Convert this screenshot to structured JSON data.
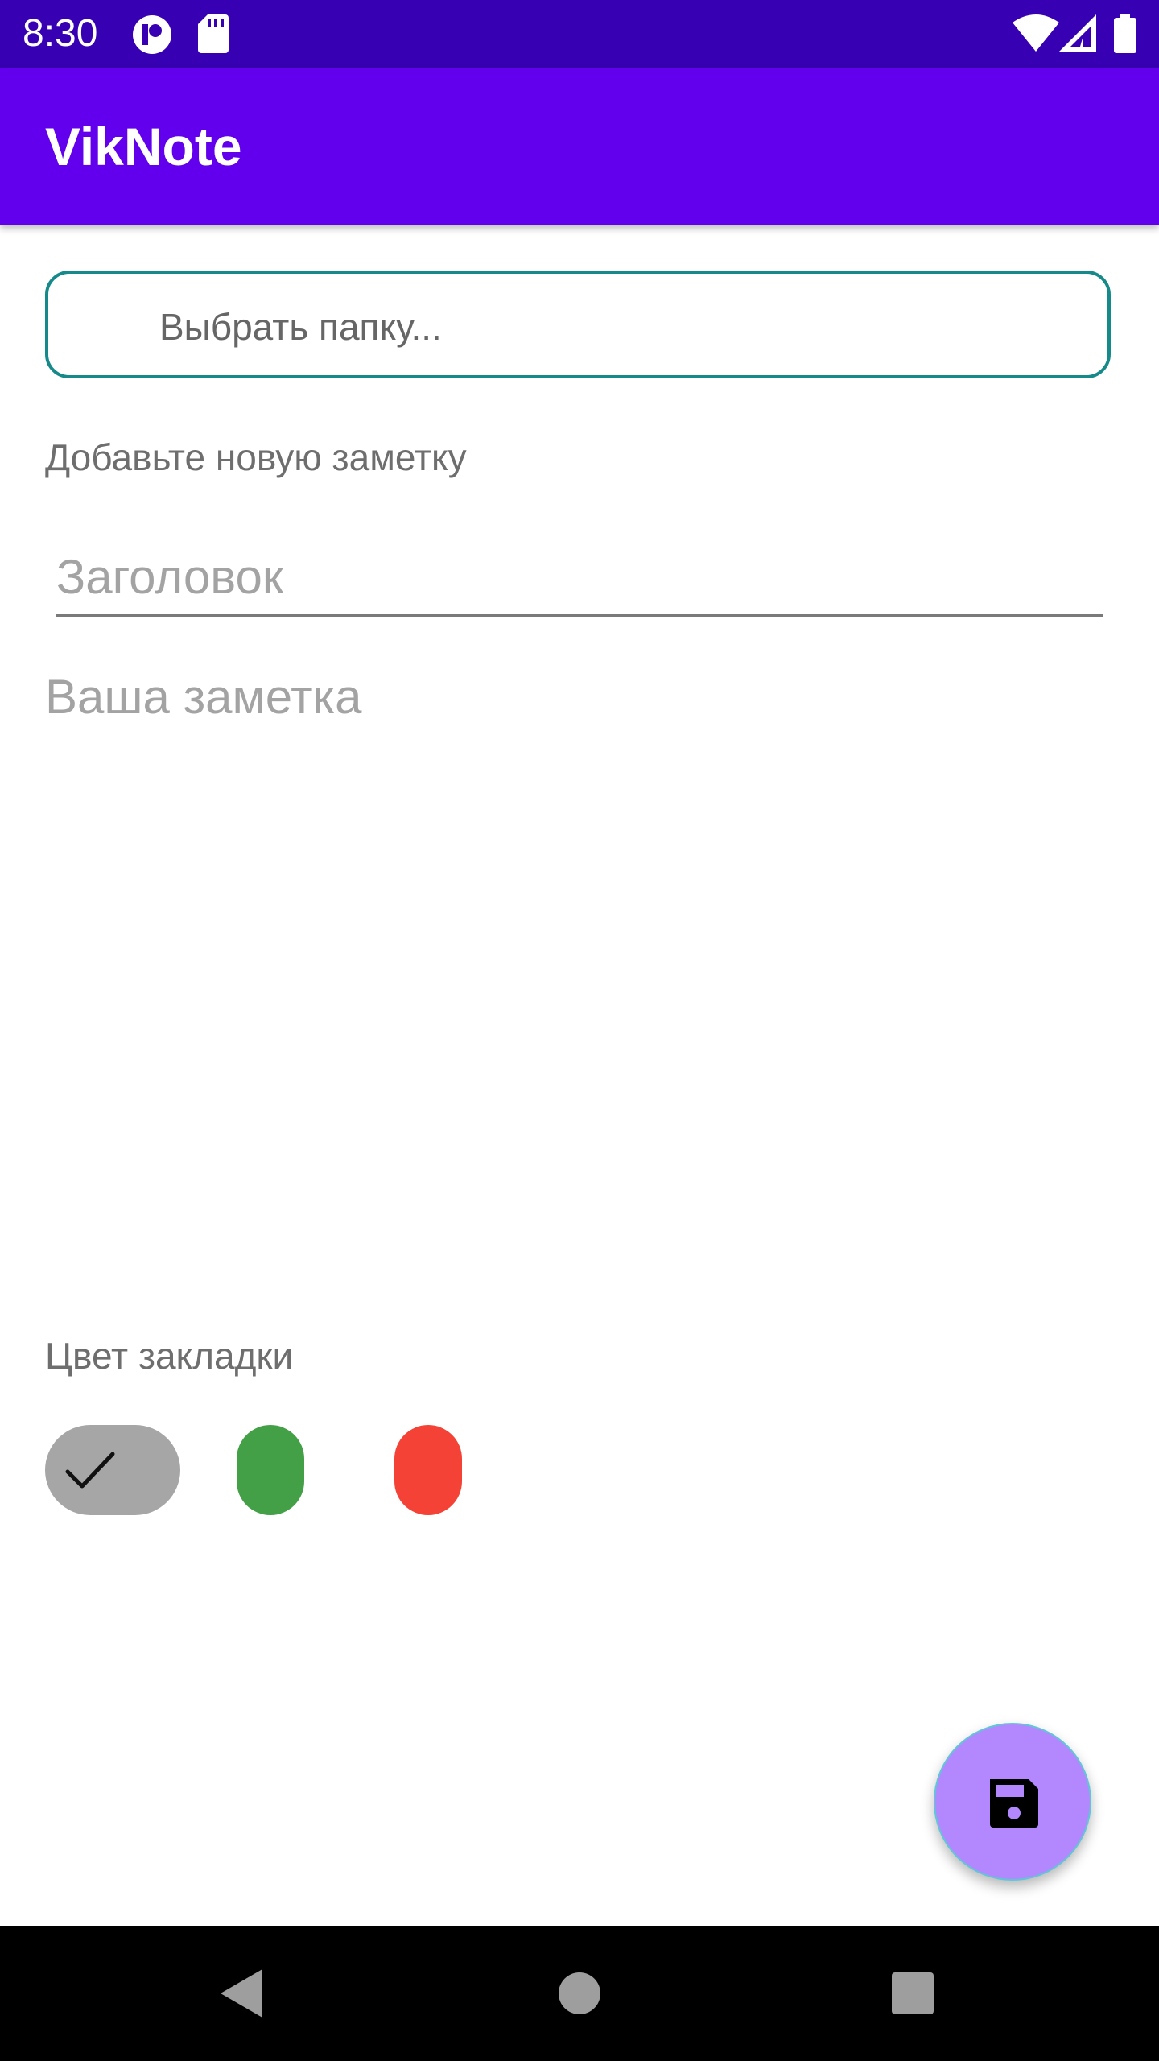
{
  "status_bar": {
    "time": "8:30",
    "icons": [
      "notification-app-icon",
      "sd-card-icon",
      "wifi-icon",
      "signal-icon",
      "battery-icon"
    ]
  },
  "app_bar": {
    "title": "VikNote"
  },
  "folder_select": {
    "placeholder": "Выбрать папку..."
  },
  "form": {
    "section_label": "Добавьте новую заметку",
    "title_placeholder": "Заголовок",
    "note_placeholder": "Ваша заметка",
    "color_label": "Цвет закладки"
  },
  "color_options": [
    {
      "name": "gray",
      "color": "#a6a6a6",
      "selected": true
    },
    {
      "name": "green",
      "color": "#43a047",
      "selected": false
    },
    {
      "name": "red",
      "color": "#f44336",
      "selected": false
    }
  ],
  "fab": {
    "icon": "save-icon",
    "color": "#b388ff"
  },
  "nav_bar": {
    "icons": [
      "back-icon",
      "home-icon",
      "recents-icon"
    ]
  },
  "colors": {
    "status_bar": "#3700b3",
    "app_bar": "#6200ee",
    "folder_border": "#168a8a"
  }
}
